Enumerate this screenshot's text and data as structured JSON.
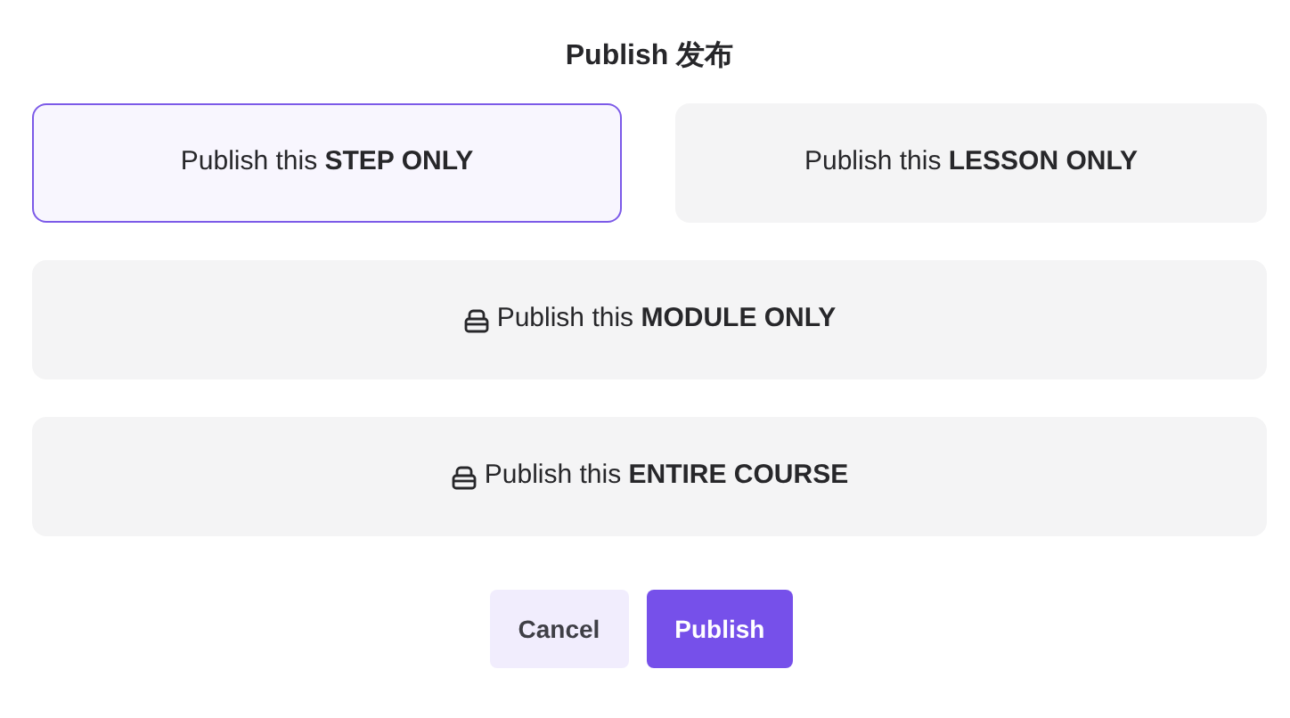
{
  "title": "Publish 发布",
  "options": [
    {
      "label": "Publish this **STEP ONLY**",
      "kind": "half",
      "icon": false,
      "selected": true
    },
    {
      "label": "Publish this **LESSON ONLY**",
      "kind": "half",
      "icon": false,
      "selected": false
    },
    {
      "label": "Publish this **MODULE ONLY**",
      "kind": "full",
      "icon": true,
      "selected": false
    },
    {
      "label": "Publish this **ENTIRE COURSE**",
      "kind": "full",
      "icon": true,
      "selected": false
    }
  ],
  "buttons": [
    {
      "label": "Cancel",
      "kind": "secondary"
    },
    {
      "label": "Publish",
      "kind": "primary"
    }
  ]
}
